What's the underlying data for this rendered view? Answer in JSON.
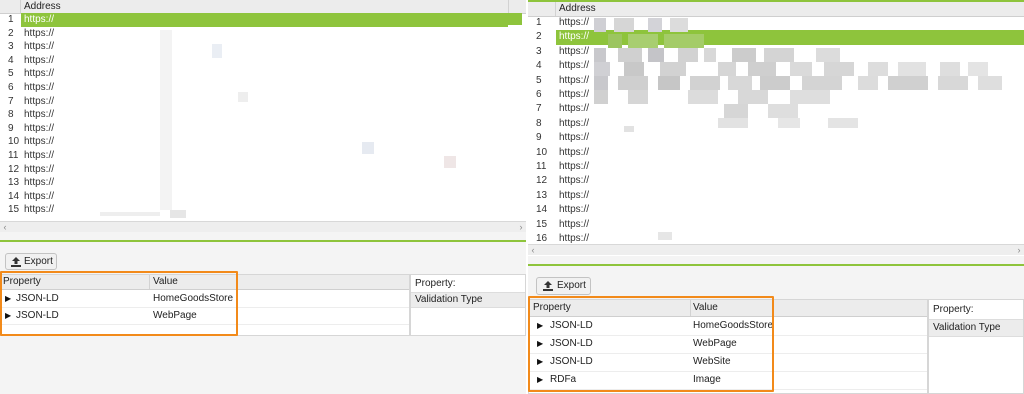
{
  "left": {
    "address_header": "Address",
    "rows": [
      {
        "n": "1",
        "url": "https://"
      },
      {
        "n": "2",
        "url": "https://"
      },
      {
        "n": "3",
        "url": "https://"
      },
      {
        "n": "4",
        "url": "https://"
      },
      {
        "n": "5",
        "url": "https://"
      },
      {
        "n": "6",
        "url": "https://"
      },
      {
        "n": "7",
        "url": "https://"
      },
      {
        "n": "8",
        "url": "https://"
      },
      {
        "n": "9",
        "url": "https://"
      },
      {
        "n": "10",
        "url": "https://"
      },
      {
        "n": "11",
        "url": "https://"
      },
      {
        "n": "12",
        "url": "https://"
      },
      {
        "n": "13",
        "url": "https://"
      },
      {
        "n": "14",
        "url": "https://"
      },
      {
        "n": "15",
        "url": "https://"
      }
    ],
    "export_label": "Export",
    "property_header": "Property",
    "value_header": "Value",
    "details": [
      {
        "property": "JSON-LD",
        "value": "HomeGoodsStore"
      },
      {
        "property": "JSON-LD",
        "value": "WebPage"
      }
    ],
    "side_property": "Property:",
    "side_validation": "Validation Type"
  },
  "right": {
    "address_header": "Address",
    "rows": [
      {
        "n": "1",
        "url": "https://"
      },
      {
        "n": "2",
        "url": "https://"
      },
      {
        "n": "3",
        "url": "https://"
      },
      {
        "n": "4",
        "url": "https://"
      },
      {
        "n": "5",
        "url": "https://"
      },
      {
        "n": "6",
        "url": "https://"
      },
      {
        "n": "7",
        "url": "https://"
      },
      {
        "n": "8",
        "url": "https://"
      },
      {
        "n": "9",
        "url": "https://"
      },
      {
        "n": "10",
        "url": "https://"
      },
      {
        "n": "11",
        "url": "https://"
      },
      {
        "n": "12",
        "url": "https://"
      },
      {
        "n": "13",
        "url": "https://"
      },
      {
        "n": "14",
        "url": "https://"
      },
      {
        "n": "15",
        "url": "https://"
      },
      {
        "n": "16",
        "url": "https://"
      }
    ],
    "export_label": "Export",
    "property_header": "Property",
    "value_header": "Value",
    "details": [
      {
        "property": "JSON-LD",
        "value": "HomeGoodsStore"
      },
      {
        "property": "JSON-LD",
        "value": "WebPage"
      },
      {
        "property": "JSON-LD",
        "value": "WebSite"
      },
      {
        "property": "RDFa",
        "value": "Image"
      }
    ],
    "side_property": "Property:",
    "side_validation": "Validation Type"
  },
  "colors": {
    "selection": "#8ec43c",
    "highlight": "#f28a1a"
  },
  "icons": {
    "export": "upload-icon",
    "expand": "triangle-right-icon"
  }
}
